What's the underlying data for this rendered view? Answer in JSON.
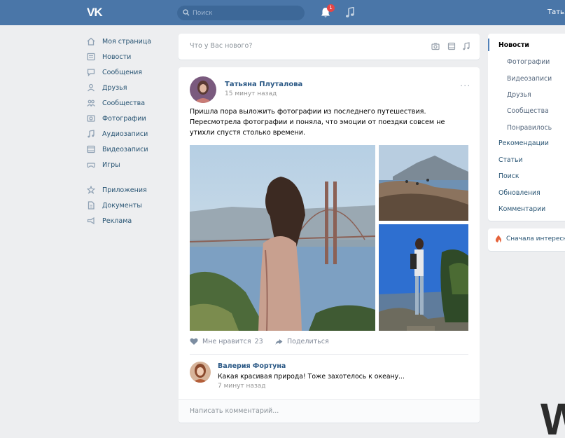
{
  "header": {
    "logo": "VK",
    "search_placeholder": "Поиск",
    "notification_count": "1",
    "user_name": "Татья"
  },
  "nav": {
    "items": [
      {
        "label": "Моя страница",
        "icon": "home-icon"
      },
      {
        "label": "Новости",
        "icon": "news-icon"
      },
      {
        "label": "Сообщения",
        "icon": "messages-icon"
      },
      {
        "label": "Друзья",
        "icon": "friends-icon"
      },
      {
        "label": "Сообщества",
        "icon": "groups-icon"
      },
      {
        "label": "Фотографии",
        "icon": "photos-icon"
      },
      {
        "label": "Аудиозаписи",
        "icon": "music-icon"
      },
      {
        "label": "Видеозаписи",
        "icon": "video-icon"
      },
      {
        "label": "Игры",
        "icon": "games-icon"
      }
    ],
    "secondary": [
      {
        "label": "Приложения",
        "icon": "apps-icon"
      },
      {
        "label": "Документы",
        "icon": "documents-icon"
      },
      {
        "label": "Реклама",
        "icon": "ads-icon"
      }
    ]
  },
  "composer": {
    "placeholder": "Что у Вас нового?"
  },
  "post": {
    "author": "Татьяна Плуталова",
    "time": "15 минут назад",
    "text": "Пришла пора выложить фотографии из последнего путешествия. Пересмотрела фотографии и поняла, что эмоции от поездки совсем не утихли спустя столько времени.",
    "like_label": "Мне нравится",
    "like_count": "23",
    "share_label": "Поделиться"
  },
  "comment": {
    "author": "Валерия Фортуна",
    "text": "Какая красивая природа! Тоже захотелось к океану...",
    "time": "7 минут назад",
    "input_placeholder": "Написать комментарий..."
  },
  "right_menu": {
    "active": "Новости",
    "sub_items": [
      "Фотографии",
      "Видеозаписи",
      "Друзья",
      "Сообщества",
      "Понравилось"
    ],
    "items": [
      "Рекомендации",
      "Статьи",
      "Поиск",
      "Обновления",
      "Комментарии"
    ]
  },
  "right_card": {
    "label": "Сначала интересное"
  },
  "watermark": "W",
  "colors": {
    "header": "#4a76a8",
    "background": "#edeef0",
    "link": "#2a5885",
    "badge": "#e64646"
  }
}
